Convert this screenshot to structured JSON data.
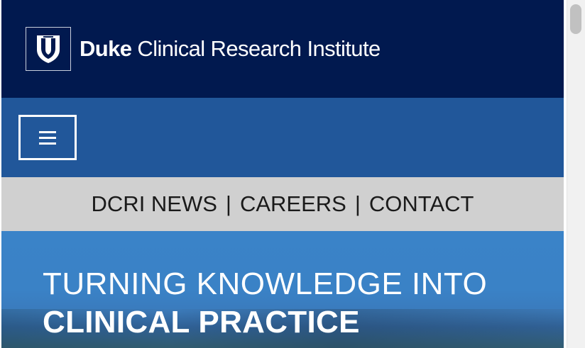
{
  "header": {
    "logo_icon": "duke-shield-icon",
    "brand": "Duke",
    "institute": "Clinical Research Institute"
  },
  "navbar": {
    "menu_icon": "hamburger-menu-icon"
  },
  "utility_nav": {
    "items": [
      "DCRI NEWS",
      "CAREERS",
      "CONTACT"
    ],
    "separator": "|"
  },
  "hero": {
    "line1": "TURNING KNOWLEDGE INTO",
    "line2": "CLINICAL PRACTICE"
  },
  "colors": {
    "header_bg": "#01194f",
    "navbar_bg": "#21579a",
    "utility_bg": "#d0d0d0",
    "hero_bg": "#3a83c8"
  }
}
